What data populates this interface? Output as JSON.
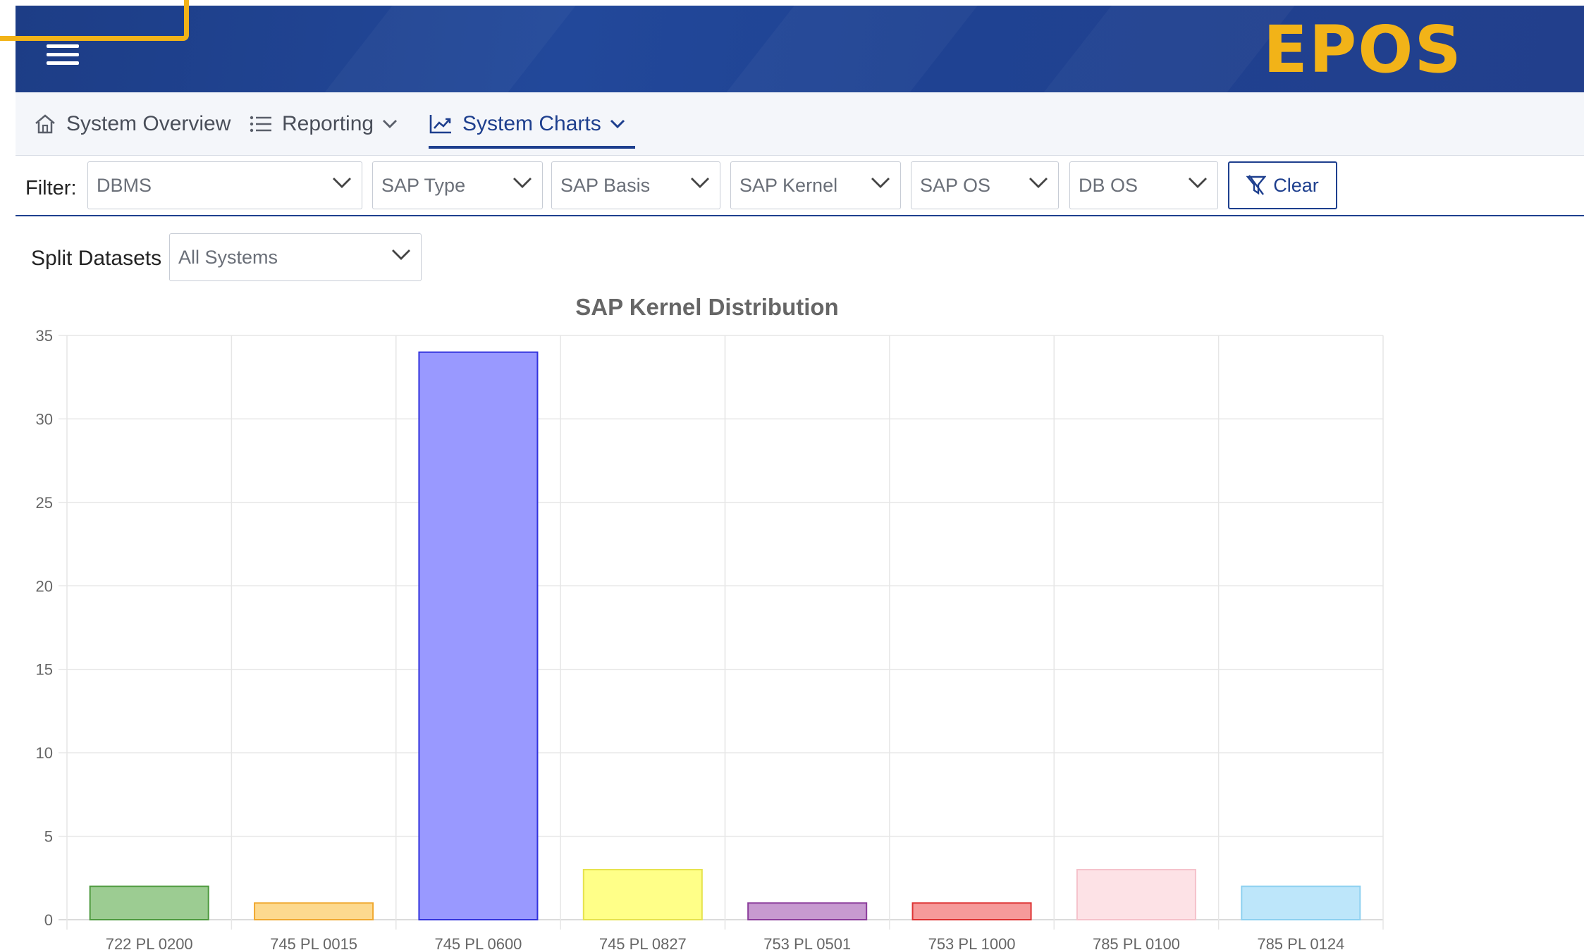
{
  "header": {
    "logo_text": "EPOS",
    "menu_icon": "hamburger-menu-icon",
    "brand_color": "#f2b318",
    "banner_color": "#1f4292"
  },
  "nav": {
    "items": [
      {
        "label": "System Overview",
        "icon": "home-icon",
        "has_dropdown": false,
        "active": false
      },
      {
        "label": "Reporting",
        "icon": "list-icon",
        "has_dropdown": true,
        "active": false
      },
      {
        "label": "System Charts",
        "icon": "chart-line-icon",
        "has_dropdown": true,
        "active": true
      }
    ]
  },
  "filters": {
    "label": "Filter:",
    "selects": [
      {
        "placeholder": "DBMS"
      },
      {
        "placeholder": "SAP Type"
      },
      {
        "placeholder": "SAP Basis"
      },
      {
        "placeholder": "SAP Kernel"
      },
      {
        "placeholder": "SAP OS"
      },
      {
        "placeholder": "DB OS"
      }
    ],
    "clear_label": "Clear"
  },
  "split": {
    "label": "Split Datasets",
    "value": "All Systems"
  },
  "chart_data": {
    "type": "bar",
    "title": "SAP Kernel Distribution",
    "xlabel": "",
    "ylabel": "",
    "ylim": [
      0,
      35
    ],
    "yticks": [
      0,
      5,
      10,
      15,
      20,
      25,
      30,
      35
    ],
    "grid": true,
    "categories": [
      "722 PL 0200",
      "745 PL 0015",
      "745 PL 0600",
      "745 PL 0827",
      "753 PL 0501",
      "753 PL 1000",
      "785 PL 0100",
      "785 PL 0124"
    ],
    "values": [
      2,
      1,
      34,
      3,
      1,
      1,
      3,
      2
    ],
    "colors": [
      {
        "fill": "#9ccc92",
        "stroke": "#4e9a3f"
      },
      {
        "fill": "#fdd98e",
        "stroke": "#f0a830"
      },
      {
        "fill": "#9999ff",
        "stroke": "#3333dd"
      },
      {
        "fill": "#ffff88",
        "stroke": "#e6e24d"
      },
      {
        "fill": "#c79ad0",
        "stroke": "#8b3d9b"
      },
      {
        "fill": "#f69a9a",
        "stroke": "#dd3333"
      },
      {
        "fill": "#fde2e6",
        "stroke": "#f5c2cb"
      },
      {
        "fill": "#bde6fa",
        "stroke": "#8dd0f0"
      }
    ]
  }
}
